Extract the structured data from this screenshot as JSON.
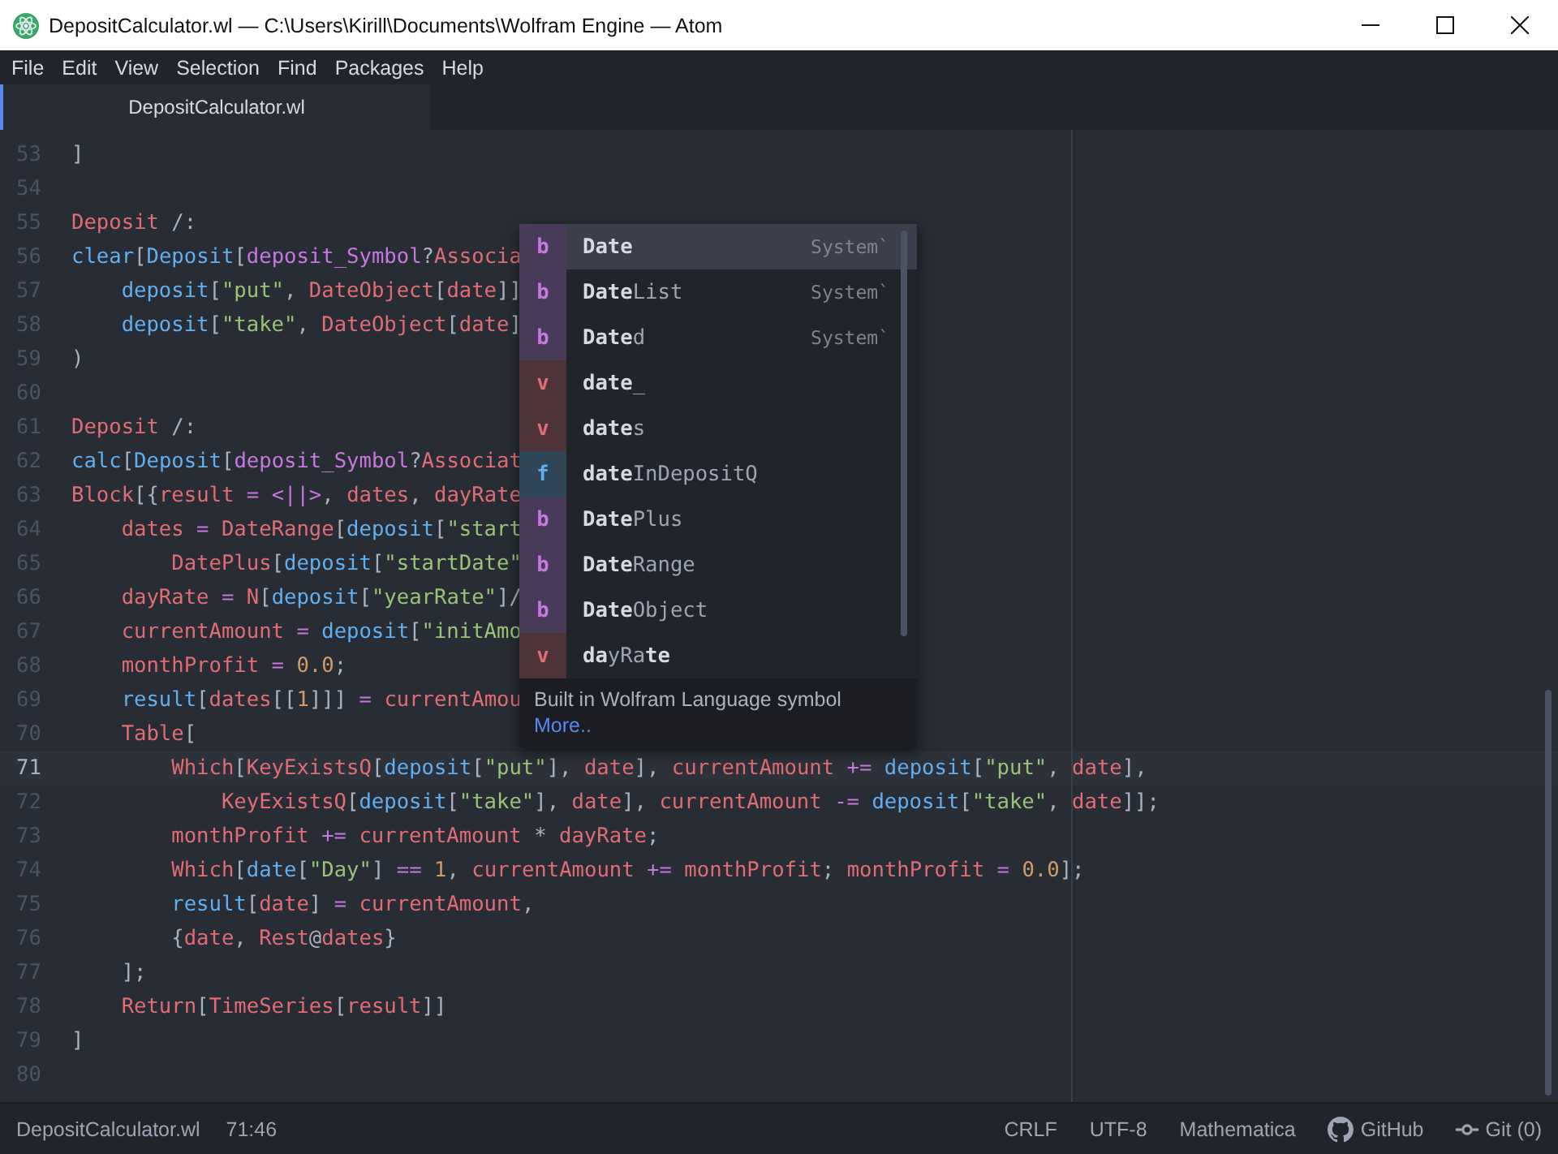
{
  "window": {
    "title": "DepositCalculator.wl — C:\\Users\\Kirill\\Documents\\Wolfram Engine — Atom"
  },
  "menu": [
    "File",
    "Edit",
    "View",
    "Selection",
    "Find",
    "Packages",
    "Help"
  ],
  "tabs": [
    {
      "label": "DepositCalculator.wl",
      "selected": true
    }
  ],
  "editor": {
    "lines": [
      {
        "number": "53",
        "current": false,
        "tokens": [
          {
            "text": "]",
            "kind": "punct"
          }
        ]
      },
      {
        "number": "54",
        "current": false
      },
      {
        "number": "55",
        "current": false,
        "tokens": [
          {
            "text": "Deposit",
            "kind": "symbol"
          },
          {
            "text": " /:",
            "kind": "punct"
          }
        ]
      },
      {
        "number": "56",
        "current": false,
        "tokens": [
          {
            "text": "clear",
            "kind": "function"
          },
          {
            "text": "[",
            "kind": "punct"
          },
          {
            "text": "Deposit",
            "kind": "function"
          },
          {
            "text": "[",
            "kind": "punct"
          },
          {
            "text": "deposit_Symbol",
            "kind": "pattern"
          },
          {
            "text": "?",
            "kind": "punct"
          },
          {
            "text": "Associa",
            "kind": "symbol"
          }
        ]
      },
      {
        "number": "57",
        "current": false,
        "tokens": [
          {
            "text": "    deposit",
            "kind": "function"
          },
          {
            "text": "[",
            "kind": "punct"
          },
          {
            "text": "\"put\"",
            "kind": "string"
          },
          {
            "text": ", ",
            "kind": "punct"
          },
          {
            "text": "DateObject",
            "kind": "symbol"
          },
          {
            "text": "[",
            "kind": "punct"
          },
          {
            "text": "date",
            "kind": "symbol"
          },
          {
            "text": "]]",
            "kind": "punct"
          }
        ]
      },
      {
        "number": "58",
        "current": false,
        "tokens": [
          {
            "text": "    deposit",
            "kind": "function"
          },
          {
            "text": "[",
            "kind": "punct"
          },
          {
            "text": "\"take\"",
            "kind": "string"
          },
          {
            "text": ", ",
            "kind": "punct"
          },
          {
            "text": "DateObject",
            "kind": "symbol"
          },
          {
            "text": "[",
            "kind": "punct"
          },
          {
            "text": "date",
            "kind": "symbol"
          },
          {
            "text": "]",
            "kind": "punct"
          }
        ]
      },
      {
        "number": "59",
        "current": false,
        "tokens": [
          {
            "text": ")",
            "kind": "punct"
          }
        ]
      },
      {
        "number": "60",
        "current": false
      },
      {
        "number": "61",
        "current": false,
        "tokens": [
          {
            "text": "Deposit",
            "kind": "symbol"
          },
          {
            "text": " /:",
            "kind": "punct"
          }
        ]
      },
      {
        "number": "62",
        "current": false,
        "tokens": [
          {
            "text": "calc",
            "kind": "function"
          },
          {
            "text": "[",
            "kind": "punct"
          },
          {
            "text": "Deposit",
            "kind": "function"
          },
          {
            "text": "[",
            "kind": "punct"
          },
          {
            "text": "deposit_Symbol",
            "kind": "pattern"
          },
          {
            "text": "?",
            "kind": "punct"
          },
          {
            "text": "Associat",
            "kind": "symbol"
          }
        ]
      },
      {
        "number": "63",
        "current": false,
        "tokens": [
          {
            "text": "Block",
            "kind": "symbol"
          },
          {
            "text": "[{",
            "kind": "punct"
          },
          {
            "text": "result",
            "kind": "symbol"
          },
          {
            "text": " = ",
            "kind": "operator"
          },
          {
            "text": "<||>",
            "kind": "operator"
          },
          {
            "text": ", ",
            "kind": "punct"
          },
          {
            "text": "dates",
            "kind": "symbol"
          },
          {
            "text": ", ",
            "kind": "punct"
          },
          {
            "text": "dayRate",
            "kind": "symbol"
          }
        ]
      },
      {
        "number": "64",
        "current": false,
        "tokens": [
          {
            "text": "    dates",
            "kind": "symbol"
          },
          {
            "text": " = ",
            "kind": "operator"
          },
          {
            "text": "DateRange",
            "kind": "symbol"
          },
          {
            "text": "[",
            "kind": "punct"
          },
          {
            "text": "deposit",
            "kind": "function"
          },
          {
            "text": "[",
            "kind": "punct"
          },
          {
            "text": "\"start",
            "kind": "string"
          }
        ]
      },
      {
        "number": "65",
        "current": false,
        "tokens": [
          {
            "text": "        DatePlus",
            "kind": "symbol"
          },
          {
            "text": "[",
            "kind": "punct"
          },
          {
            "text": "deposit",
            "kind": "function"
          },
          {
            "text": "[",
            "kind": "punct"
          },
          {
            "text": "\"startDate\"",
            "kind": "string"
          }
        ]
      },
      {
        "number": "66",
        "current": false,
        "tokens": [
          {
            "text": "    dayRate",
            "kind": "symbol"
          },
          {
            "text": " = ",
            "kind": "operator"
          },
          {
            "text": "N",
            "kind": "symbol"
          },
          {
            "text": "[",
            "kind": "punct"
          },
          {
            "text": "deposit",
            "kind": "function"
          },
          {
            "text": "[",
            "kind": "punct"
          },
          {
            "text": "\"yearRate\"",
            "kind": "string"
          },
          {
            "text": "]/",
            "kind": "punct"
          }
        ]
      },
      {
        "number": "67",
        "current": false,
        "tokens": [
          {
            "text": "    currentAmount",
            "kind": "symbol"
          },
          {
            "text": " = ",
            "kind": "operator"
          },
          {
            "text": "deposit",
            "kind": "function"
          },
          {
            "text": "[",
            "kind": "punct"
          },
          {
            "text": "\"initAmo",
            "kind": "string"
          }
        ]
      },
      {
        "number": "68",
        "current": false,
        "tokens": [
          {
            "text": "    monthProfit",
            "kind": "symbol"
          },
          {
            "text": " = ",
            "kind": "operator"
          },
          {
            "text": "0.0",
            "kind": "number"
          },
          {
            "text": ";",
            "kind": "punct"
          }
        ]
      },
      {
        "number": "69",
        "current": false,
        "tokens": [
          {
            "text": "    result",
            "kind": "function"
          },
          {
            "text": "[",
            "kind": "punct"
          },
          {
            "text": "dates",
            "kind": "symbol"
          },
          {
            "text": "[[",
            "kind": "punct"
          },
          {
            "text": "1",
            "kind": "number"
          },
          {
            "text": "]]]",
            "kind": "punct"
          },
          {
            "text": " = ",
            "kind": "operator"
          },
          {
            "text": "currentAmou",
            "kind": "symbol"
          }
        ]
      },
      {
        "number": "70",
        "current": false,
        "tokens": [
          {
            "text": "    Table",
            "kind": "symbol"
          },
          {
            "text": "[",
            "kind": "punct"
          }
        ]
      },
      {
        "number": "71",
        "current": true,
        "tokens": [
          {
            "text": "        Which",
            "kind": "symbol"
          },
          {
            "text": "[",
            "kind": "punct"
          },
          {
            "text": "KeyExistsQ",
            "kind": "symbol"
          },
          {
            "text": "[",
            "kind": "punct"
          },
          {
            "text": "deposit",
            "kind": "function"
          },
          {
            "text": "[",
            "kind": "punct"
          },
          {
            "text": "\"put\"",
            "kind": "string"
          },
          {
            "text": "], ",
            "kind": "punct"
          },
          {
            "text": "date",
            "kind": "symbol"
          },
          {
            "text": "], ",
            "kind": "punct"
          },
          {
            "text": "currentAmount",
            "kind": "symbol"
          },
          {
            "text": " += ",
            "kind": "operator"
          },
          {
            "text": "deposit",
            "kind": "function"
          },
          {
            "text": "[",
            "kind": "punct"
          },
          {
            "text": "\"put\"",
            "kind": "string"
          },
          {
            "text": ", ",
            "kind": "punct"
          },
          {
            "text": "date",
            "kind": "symbol"
          },
          {
            "text": "],",
            "kind": "punct"
          }
        ]
      },
      {
        "number": "72",
        "current": false,
        "tokens": [
          {
            "text": "            KeyExistsQ",
            "kind": "symbol"
          },
          {
            "text": "[",
            "kind": "punct"
          },
          {
            "text": "deposit",
            "kind": "function"
          },
          {
            "text": "[",
            "kind": "punct"
          },
          {
            "text": "\"take\"",
            "kind": "string"
          },
          {
            "text": "], ",
            "kind": "punct"
          },
          {
            "text": "date",
            "kind": "symbol"
          },
          {
            "text": "], ",
            "kind": "punct"
          },
          {
            "text": "currentAmount",
            "kind": "symbol"
          },
          {
            "text": " -= ",
            "kind": "operator"
          },
          {
            "text": "deposit",
            "kind": "function"
          },
          {
            "text": "[",
            "kind": "punct"
          },
          {
            "text": "\"take\"",
            "kind": "string"
          },
          {
            "text": ", ",
            "kind": "punct"
          },
          {
            "text": "date",
            "kind": "symbol"
          },
          {
            "text": "]];",
            "kind": "punct"
          }
        ]
      },
      {
        "number": "73",
        "current": false,
        "tokens": [
          {
            "text": "        monthProfit",
            "kind": "symbol"
          },
          {
            "text": " += ",
            "kind": "operator"
          },
          {
            "text": "currentAmount",
            "kind": "symbol"
          },
          {
            "text": " * ",
            "kind": "punct"
          },
          {
            "text": "dayRate",
            "kind": "symbol"
          },
          {
            "text": ";",
            "kind": "punct"
          }
        ]
      },
      {
        "number": "74",
        "current": false,
        "tokens": [
          {
            "text": "        Which",
            "kind": "symbol"
          },
          {
            "text": "[",
            "kind": "punct"
          },
          {
            "text": "date",
            "kind": "function"
          },
          {
            "text": "[",
            "kind": "punct"
          },
          {
            "text": "\"Day\"",
            "kind": "string"
          },
          {
            "text": "]",
            "kind": "punct"
          },
          {
            "text": " == ",
            "kind": "operator"
          },
          {
            "text": "1",
            "kind": "number"
          },
          {
            "text": ", ",
            "kind": "punct"
          },
          {
            "text": "currentAmount",
            "kind": "symbol"
          },
          {
            "text": " += ",
            "kind": "operator"
          },
          {
            "text": "monthProfit",
            "kind": "symbol"
          },
          {
            "text": "; ",
            "kind": "punct"
          },
          {
            "text": "monthProfit",
            "kind": "symbol"
          },
          {
            "text": " = ",
            "kind": "operator"
          },
          {
            "text": "0.0",
            "kind": "number"
          },
          {
            "text": "];",
            "kind": "punct"
          }
        ]
      },
      {
        "number": "75",
        "current": false,
        "tokens": [
          {
            "text": "        result",
            "kind": "function"
          },
          {
            "text": "[",
            "kind": "punct"
          },
          {
            "text": "date",
            "kind": "symbol"
          },
          {
            "text": "]",
            "kind": "punct"
          },
          {
            "text": " = ",
            "kind": "operator"
          },
          {
            "text": "currentAmount",
            "kind": "symbol"
          },
          {
            "text": ",",
            "kind": "punct"
          }
        ]
      },
      {
        "number": "76",
        "current": false,
        "tokens": [
          {
            "text": "        {",
            "kind": "punct"
          },
          {
            "text": "date",
            "kind": "symbol"
          },
          {
            "text": ", ",
            "kind": "punct"
          },
          {
            "text": "Rest",
            "kind": "symbol"
          },
          {
            "text": "@",
            "kind": "punct"
          },
          {
            "text": "dates",
            "kind": "symbol"
          },
          {
            "text": "}",
            "kind": "punct"
          }
        ]
      },
      {
        "number": "77",
        "current": false,
        "tokens": [
          {
            "text": "    ];",
            "kind": "punct"
          }
        ]
      },
      {
        "number": "78",
        "current": false,
        "tokens": [
          {
            "text": "    Return",
            "kind": "symbol"
          },
          {
            "text": "[",
            "kind": "punct"
          },
          {
            "text": "TimeSeries",
            "kind": "symbol"
          },
          {
            "text": "[",
            "kind": "punct"
          },
          {
            "text": "result",
            "kind": "symbol"
          },
          {
            "text": "]]",
            "kind": "punct"
          }
        ]
      },
      {
        "number": "79",
        "current": false,
        "tokens": [
          {
            "text": "]",
            "kind": "punct"
          }
        ]
      },
      {
        "number": "80",
        "current": false
      }
    ]
  },
  "autocomplete": {
    "items": [
      {
        "badge": "b",
        "kind": "builtin",
        "name": "**Date**",
        "context": "System`",
        "selected": true
      },
      {
        "badge": "b",
        "kind": "builtin",
        "name": "**Date**List",
        "context": "System`",
        "selected": false
      },
      {
        "badge": "b",
        "kind": "builtin",
        "name": "**Date**d",
        "context": "System`",
        "selected": false
      },
      {
        "badge": "v",
        "kind": "variable",
        "name": "**date**_",
        "selected": false
      },
      {
        "badge": "v",
        "kind": "variable",
        "name": "**date**s",
        "selected": false
      },
      {
        "badge": "f",
        "kind": "function",
        "name": "**date**InDepositQ",
        "selected": false
      },
      {
        "badge": "b",
        "kind": "builtin",
        "name": "**Date**Plus",
        "selected": false
      },
      {
        "badge": "b",
        "kind": "builtin",
        "name": "**Date**Range",
        "selected": false
      },
      {
        "badge": "b",
        "kind": "builtin",
        "name": "**Date**Object",
        "selected": false
      },
      {
        "badge": "v",
        "kind": "variable",
        "name": "**da**yRa**te**",
        "selected": false
      }
    ],
    "description": "Built in Wolfram Language symbol",
    "more_link": "More.."
  },
  "status_bar": {
    "file": "DepositCalculator.wl",
    "cursor_position": "71:46",
    "line_ending": "CRLF",
    "encoding": "UTF-8",
    "grammar": "Mathematica",
    "github": "GitHub",
    "git": "Git (0)"
  }
}
